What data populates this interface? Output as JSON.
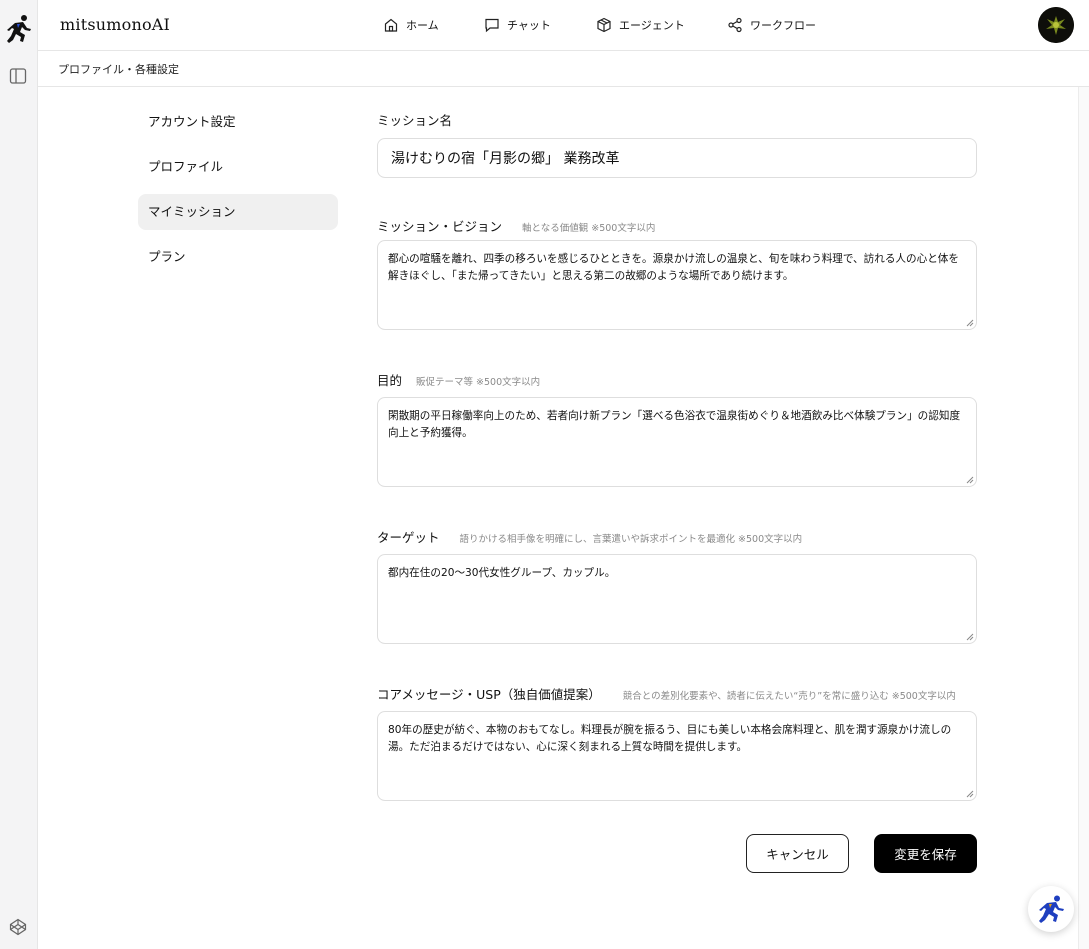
{
  "app": {
    "brand": "mitsumonoAI"
  },
  "nav": {
    "home": "ホーム",
    "chat": "チャット",
    "agent": "エージェント",
    "workflow": "ワークフロー"
  },
  "breadcrumb": "プロファイル・各種設定",
  "sidebar": {
    "items": [
      {
        "label": "アカウント設定"
      },
      {
        "label": "プロファイル"
      },
      {
        "label": "マイミッション",
        "active": true
      },
      {
        "label": "プラン"
      }
    ]
  },
  "form": {
    "mission_name": {
      "label": "ミッション名",
      "value": "湯けむりの宿「月影の郷」 業務改革"
    },
    "vision": {
      "label": "ミッション・ビジョン",
      "hint": "軸となる価値観 ※500文字以内",
      "value": "都心の喧騒を離れ、四季の移ろいを感じるひとときを。源泉かけ流しの温泉と、旬を味わう料理で、訪れる人の心と体を解きほぐし、「また帰ってきたい」と思える第二の故郷のような場所であり続けます。"
    },
    "purpose": {
      "label": "目的",
      "hint": "販促テーマ等 ※500文字以内",
      "value": "閑散期の平日稼働率向上のため、若者向け新プラン「選べる色浴衣で温泉街めぐり＆地酒飲み比べ体験プラン」の認知度向上と予約獲得。"
    },
    "target": {
      "label": "ターゲット",
      "hint": "語りかける相手像を明確にし、言葉遣いや訴求ポイントを最適化 ※500文字以内",
      "value": "都内在住の20〜30代女性グループ、カップル。"
    },
    "core_message": {
      "label": "コアメッセージ・USP（独自価値提案）",
      "hint": "競合との差別化要素や、読者に伝えたい“売り”を常に盛り込む ※500文字以内",
      "value": "80年の歴史が紡ぐ、本物のおもてなし。料理長が腕を振るう、目にも美しい本格会席料理と、肌を潤す源泉かけ流しの湯。ただ泊まるだけではない、心に深く刻まれる上質な時間を提供します。"
    }
  },
  "buttons": {
    "cancel": "キャンセル",
    "save": "変更を保存"
  }
}
